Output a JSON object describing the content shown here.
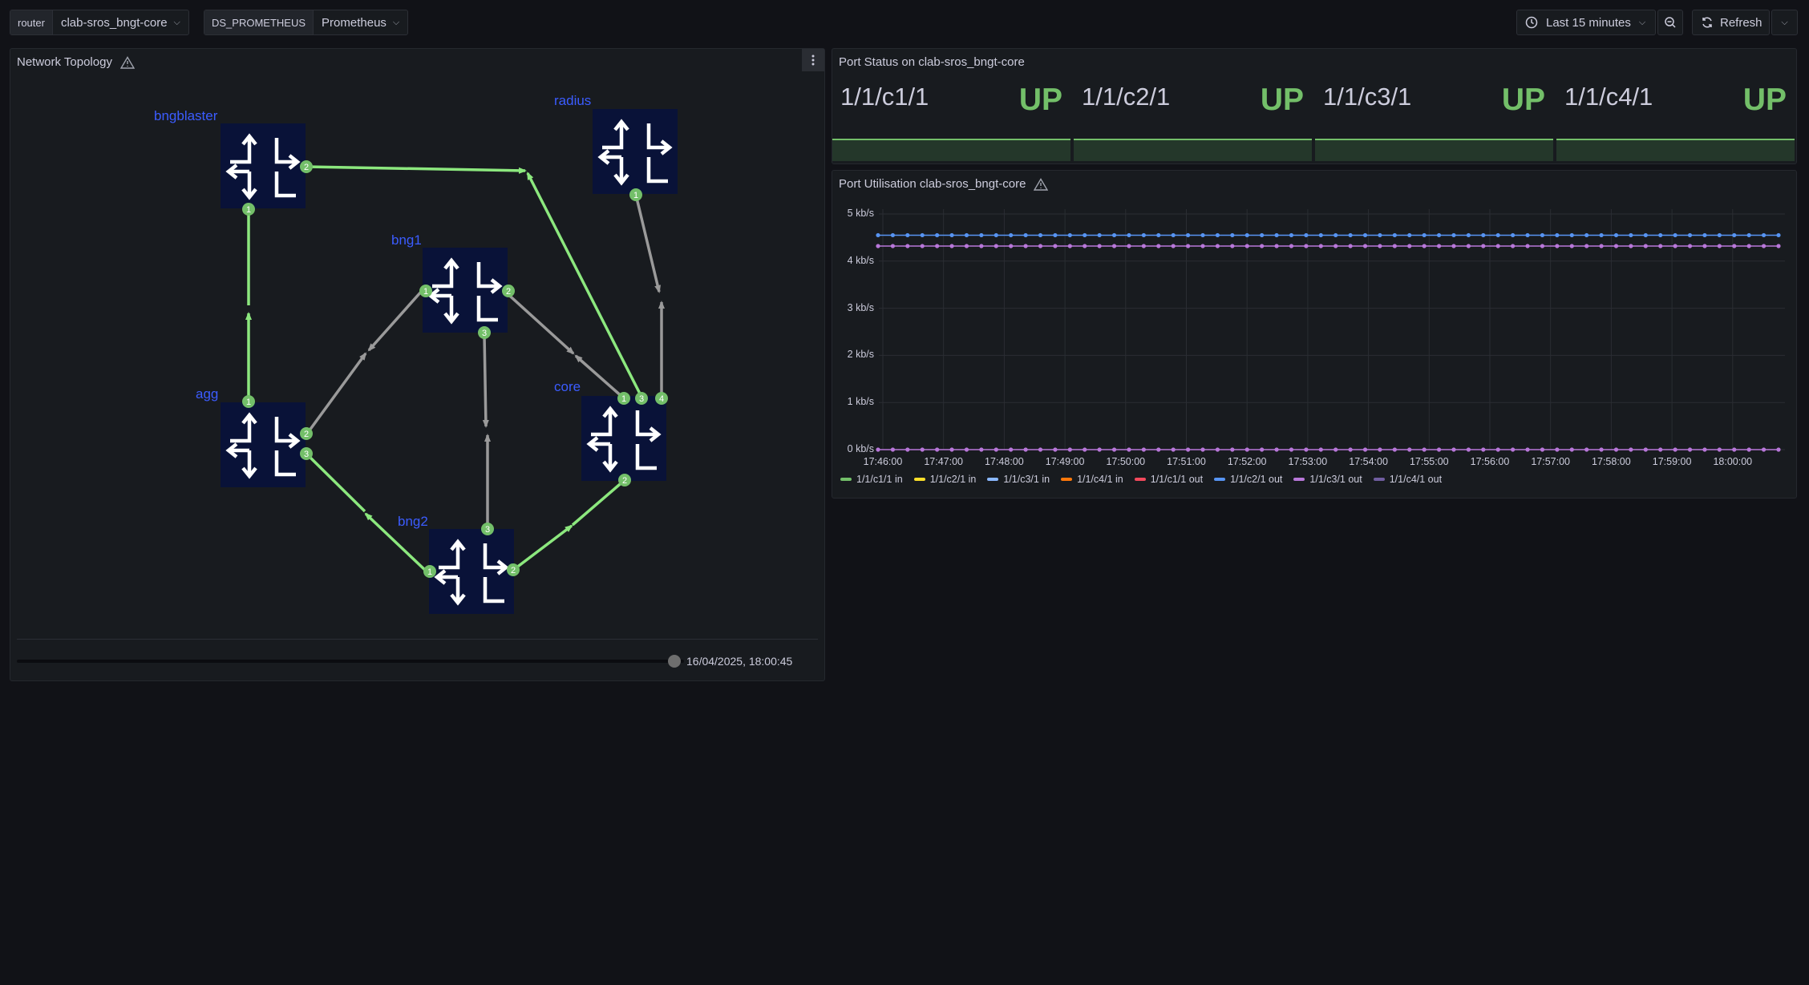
{
  "vars": {
    "router_label": "router",
    "router_value": "clab-sros_bngt-core",
    "ds_label": "DS_PROMETHEUS",
    "ds_value": "Prometheus"
  },
  "toolbar": {
    "time_range": "Last 15 minutes",
    "refresh_label": "Refresh"
  },
  "topology": {
    "title": "Network Topology",
    "timestamp": "16/04/2025, 18:00:45",
    "nodes": [
      {
        "name": "bngblaster"
      },
      {
        "name": "radius"
      },
      {
        "name": "bng1"
      },
      {
        "name": "agg"
      },
      {
        "name": "core"
      },
      {
        "name": "bng2"
      }
    ],
    "colors": {
      "link_up": "#8ce87e",
      "link_other": "#9a9a9a",
      "node_bg": "#091238",
      "port": "#73bf69"
    }
  },
  "port_status": {
    "title": "Port Status on clab-sros_bngt-core",
    "ports": [
      {
        "name": "1/1/c1/1",
        "status": "UP"
      },
      {
        "name": "1/1/c2/1",
        "status": "UP"
      },
      {
        "name": "1/1/c3/1",
        "status": "UP"
      },
      {
        "name": "1/1/c4/1",
        "status": "UP"
      }
    ]
  },
  "utilisation": {
    "title": "Port Utilisation clab-sros_bngt-core",
    "y_ticks": [
      "5 kb/s",
      "4 kb/s",
      "3 kb/s",
      "2 kb/s",
      "1 kb/s",
      "0 kb/s"
    ],
    "x_ticks": [
      "17:46:00",
      "17:47:00",
      "17:48:00",
      "17:49:00",
      "17:50:00",
      "17:51:00",
      "17:52:00",
      "17:53:00",
      "17:54:00",
      "17:55:00",
      "17:56:00",
      "17:57:00",
      "17:58:00",
      "17:59:00",
      "18:00:00"
    ],
    "legend": [
      {
        "name": "1/1/c1/1 in",
        "color": "#73bf69"
      },
      {
        "name": "1/1/c2/1 in",
        "color": "#fade2a"
      },
      {
        "name": "1/1/c3/1 in",
        "color": "#8ab8ff"
      },
      {
        "name": "1/1/c4/1 in",
        "color": "#ff780a"
      },
      {
        "name": "1/1/c1/1 out",
        "color": "#f2495c"
      },
      {
        "name": "1/1/c2/1 out",
        "color": "#5794f2"
      },
      {
        "name": "1/1/c3/1 out",
        "color": "#b877d9"
      },
      {
        "name": "1/1/c4/1 out",
        "color": "#705da0"
      }
    ]
  },
  "chart_data": {
    "type": "line",
    "title": "Port Utilisation clab-sros_bngt-core",
    "ylabel": "",
    "xlabel": "",
    "ylim": [
      0,
      5
    ],
    "y_unit": "kb/s",
    "x": [
      "17:46:00",
      "17:47:00",
      "17:48:00",
      "17:49:00",
      "17:50:00",
      "17:51:00",
      "17:52:00",
      "17:53:00",
      "17:54:00",
      "17:55:00",
      "17:56:00",
      "17:57:00",
      "17:58:00",
      "17:59:00",
      "18:00:00"
    ],
    "series": [
      {
        "name": "1/1/c2/1 out",
        "color": "#5794f2",
        "value": 4.55
      },
      {
        "name": "1/1/c3/1 out",
        "color": "#b877d9",
        "value": 4.32
      },
      {
        "name": "1/1/c3/1 out",
        "color": "#b877d9",
        "value": 0
      }
    ],
    "grid": true,
    "legend": "bottom"
  }
}
